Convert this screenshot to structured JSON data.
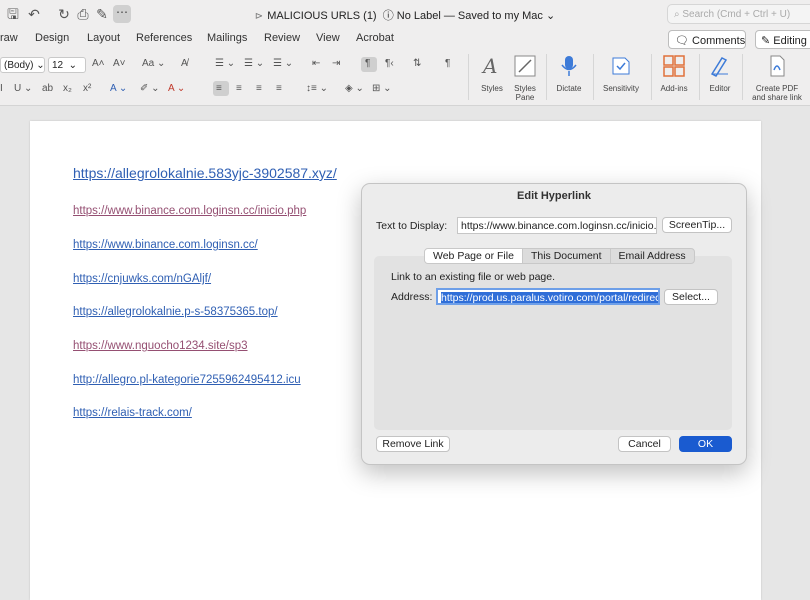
{
  "titlebar": {
    "doc_mark": "⊳",
    "doc_name": "MALICIOUS URLS (1)",
    "label_status": "ⓘ No Label — Saved to my Mac",
    "search_placeholder": "Search (Cmd + Ctrl + U)",
    "more": "⋯"
  },
  "menu": [
    "raw",
    "Design",
    "Layout",
    "References",
    "Mailings",
    "Review",
    "View",
    "Acrobat"
  ],
  "comments_label": "Comments",
  "editing_label": "Editing",
  "ribbon": {
    "font_name": "(Body)",
    "font_size": "12",
    "styles": "Styles",
    "styles_pane": "Styles\nPane",
    "dictate": "Dictate",
    "sensitivity": "Sensitivity",
    "addins": "Add-ins",
    "editor": "Editor",
    "create_pdf": "Create PDF\nand share link"
  },
  "document": {
    "links": [
      "https://allegrolokalnie.583yjc-3902587.xyz/",
      "https://www.binance.com.loginsn.cc/inicio.php",
      "https://www.binance.com.loginsn.cc/",
      "https://cnjuwks.com/nGAljf/",
      "https://allegrolokalnie.p-s-58375365.top/",
      "https://www.nguocho1234.site/sp3",
      "http://allegro.pl-kategorie7255962495412.icu",
      "https://relais-track.com/"
    ]
  },
  "dialog": {
    "title": "Edit Hyperlink",
    "text_to_display_label": "Text to Display:",
    "text_to_display_value": "https://www.binance.com.loginsn.cc/inicio.php",
    "screentip": "ScreenTip...",
    "tabs": [
      "Web Page or File",
      "This Document",
      "Email Address"
    ],
    "link_hint": "Link to an existing file or web page.",
    "address_label": "Address:",
    "address_value": "https://prod.us.paralus.votiro.com/portal/redirect",
    "select": "Select...",
    "remove_link": "Remove Link",
    "cancel": "Cancel",
    "ok": "OK"
  },
  "colors": {
    "link_blue": "#2f5fb3",
    "link_visited": "#954f72",
    "accent": "#1a5bd0"
  }
}
